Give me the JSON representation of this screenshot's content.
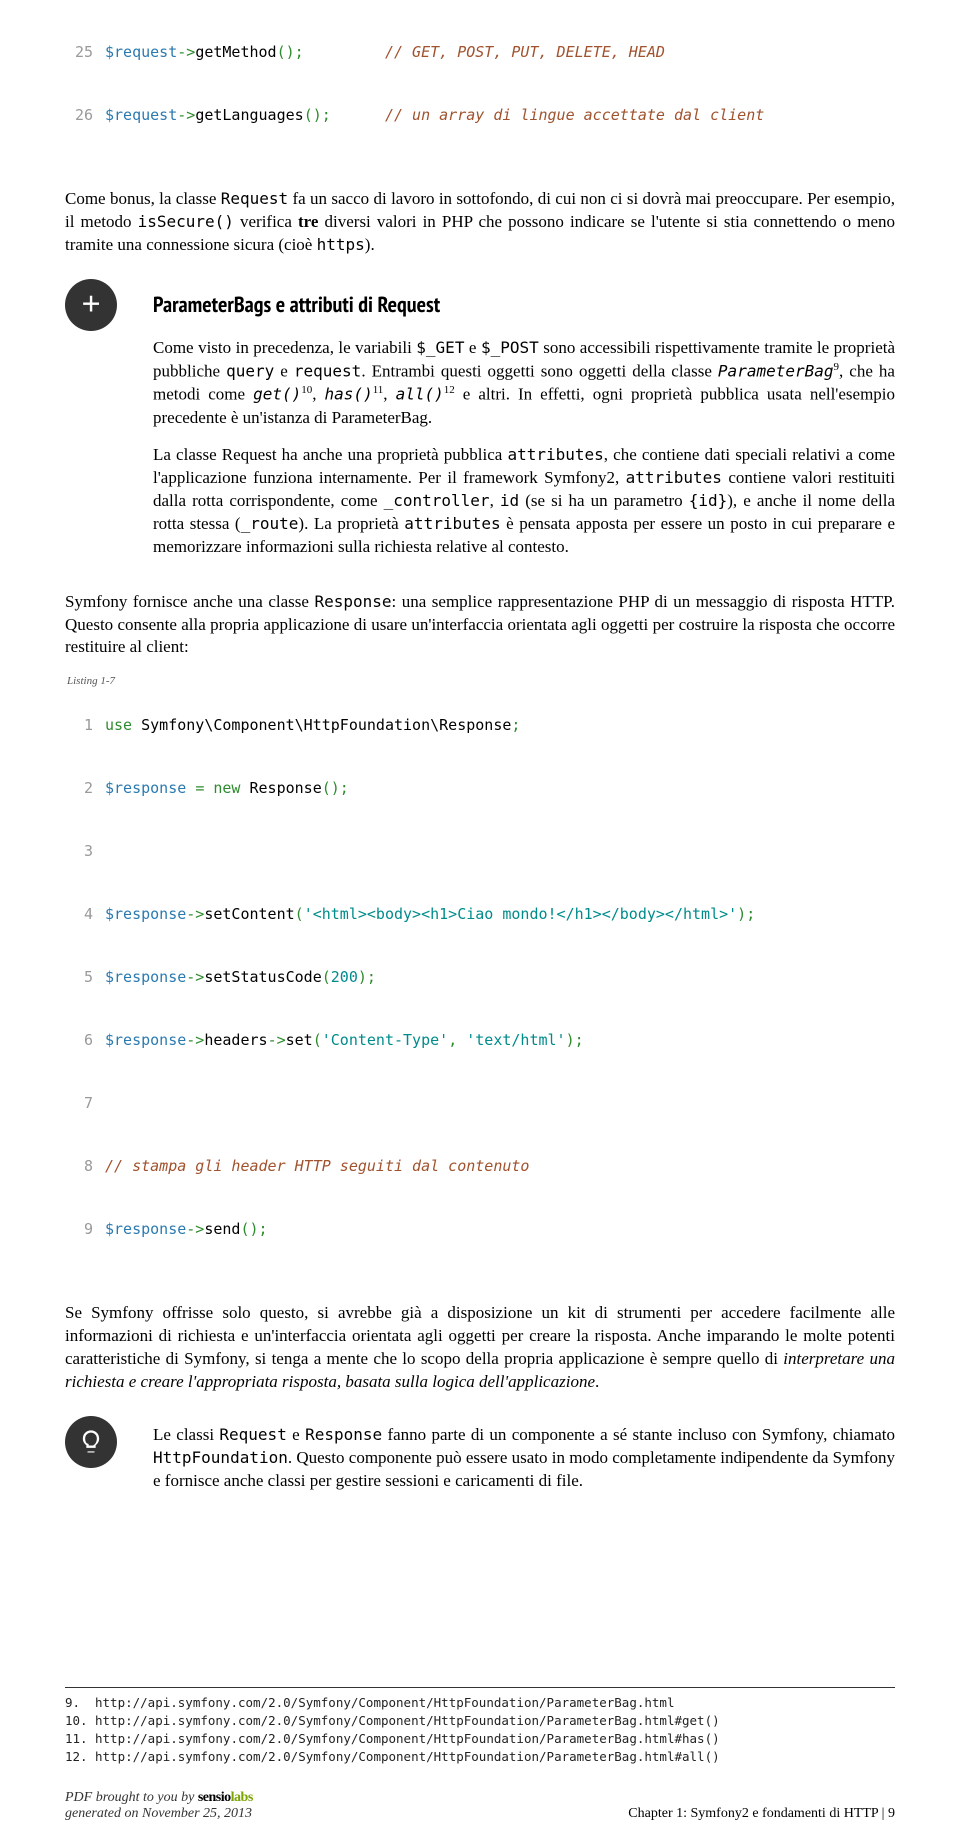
{
  "code1": {
    "lines": [
      {
        "n": "25",
        "var": "$request",
        "arrow": "->",
        "fn": "getMethod",
        "parens": "();",
        "pad": "         ",
        "comment": "// GET, POST, PUT, DELETE, HEAD"
      },
      {
        "n": "26",
        "var": "$request",
        "arrow": "->",
        "fn": "getLanguages",
        "parens": "();",
        "pad": "      ",
        "comment": "// un array di lingue accettate dal client"
      }
    ]
  },
  "para1": {
    "t1": "Come bonus, la classe ",
    "c1": "Request",
    "t2": " fa un sacco di lavoro in sottofondo, di cui non ci si dovrà mai preoccupare. Per esempio, il metodo ",
    "c2": "isSecure()",
    "t3": " verifica ",
    "b1": "tre",
    "t4": " diversi valori in PHP che possono indicare se l'utente si stia connettendo o meno tramite una connessione sicura (cioè ",
    "c3": "https",
    "t5": ")."
  },
  "callout1": {
    "title": "ParameterBags e attributi di Request",
    "p1": {
      "t1": "Come visto in precedenza, le variabili ",
      "c1": "$_GET",
      "t2": " e ",
      "c2": "$_POST",
      "t3": " sono accessibili rispettivamente tramite le proprietà pubbliche ",
      "c3": "query",
      "t4": " e ",
      "c4": "request",
      "t5": ". Entrambi questi oggetti sono oggetti della classe ",
      "c5": "ParameterBag",
      "s1": "9",
      "t6": ", che ha metodi come ",
      "c6": "get()",
      "s2": "10",
      "t7": ", ",
      "c7": "has()",
      "s3": "11",
      "t8": ", ",
      "c8": "all()",
      "s4": "12",
      "t9": " e altri. In effetti, ogni proprietà pubblica usata nell'esempio precedente è un'istanza di ParameterBag."
    },
    "p2": {
      "t1": "La classe Request ha anche una proprietà pubblica ",
      "c1": "attributes",
      "t2": ", che contiene dati speciali relativi a come l'applicazione funziona internamente. Per il framework Symfony2, ",
      "c2": "attributes",
      "t3": " contiene valori restituiti dalla rotta corrispondente, come ",
      "c3": "_controller",
      "t4": ", ",
      "c4": "id",
      "t5": " (se si ha un parametro ",
      "c5": "{id}",
      "t6": "), e anche il nome della rotta stessa (",
      "c6": "_route",
      "t7": "). La proprietà ",
      "c7": "attributes",
      "t8": " è pensata apposta per essere un posto in cui preparare e memorizzare informazioni sulla richiesta relative al contesto."
    }
  },
  "para2": {
    "t1": "Symfony fornisce anche una classe ",
    "c1": "Response",
    "t2": ": una semplice rappresentazione PHP di un messaggio di risposta HTTP. Questo consente alla propria applicazione di usare un'interfaccia orientata agli oggetti per costruire la risposta che occorre restituire al client:"
  },
  "listing": {
    "label": "Listing 1-7"
  },
  "code2": {
    "l1": {
      "n": "1",
      "use": "use",
      "ns": " Symfony\\Component\\HttpFoundation\\Response",
      "sc": ";"
    },
    "l2": {
      "n": "2",
      "v": "$response ",
      "eq": "=",
      "sp": " ",
      "new": "new",
      "cls": " Response",
      "p": "();"
    },
    "l3": {
      "n": "3"
    },
    "l4": {
      "n": "4",
      "v": "$response",
      "ar": "->",
      "fn": "setContent",
      "op": "(",
      "s": "'<html><body><h1>Ciao mondo!</h1></body></html>'",
      "cp": ");"
    },
    "l5": {
      "n": "5",
      "v": "$response",
      "ar": "->",
      "fn": "setStatusCode",
      "op": "(",
      "num": "200",
      "cp": ");"
    },
    "l6": {
      "n": "6",
      "v": "$response",
      "ar": "->",
      "fn": "headers",
      "ar2": "->",
      "fn2": "set",
      "op": "(",
      "s1": "'Content-Type'",
      "cm": ",",
      "sp": " ",
      "s2": "'text/html'",
      "cp": ");"
    },
    "l7": {
      "n": "7"
    },
    "l8": {
      "n": "8",
      "c": "// stampa gli header HTTP seguiti dal contenuto"
    },
    "l9": {
      "n": "9",
      "v": "$response",
      "ar": "->",
      "fn": "send",
      "p": "();"
    }
  },
  "para3": {
    "t1": "Se Symfony offrisse solo questo, si avrebbe già a disposizione un kit di strumenti per accedere facilmente alle informazioni di richiesta e un'interfaccia orientata agli oggetti per creare la risposta. Anche imparando le molte potenti caratteristiche di Symfony, si tenga a mente che lo scopo della propria applicazione è sempre quello di ",
    "i1": "interpretare una richiesta e creare l'appropriata risposta, basata sulla logica dell'applicazione",
    "t2": "."
  },
  "callout2": {
    "t1": "Le classi ",
    "c1": "Request",
    "t2": " e ",
    "c2": "Response",
    "t3": " fanno parte di un componente a sé stante incluso con Symfony, chiamato ",
    "c3": "HttpFoundation",
    "t4": ". Questo componente può essere usato in modo completamente indipendente da Symfony e fornisce anche classi per gestire sessioni e caricamenti di file."
  },
  "footnotes": [
    {
      "n": "9.",
      "url": "http://api.symfony.com/2.0/Symfony/Component/HttpFoundation/ParameterBag.html"
    },
    {
      "n": "10.",
      "url": "http://api.symfony.com/2.0/Symfony/Component/HttpFoundation/ParameterBag.html#get()"
    },
    {
      "n": "11.",
      "url": "http://api.symfony.com/2.0/Symfony/Component/HttpFoundation/ParameterBag.html#has()"
    },
    {
      "n": "12.",
      "url": "http://api.symfony.com/2.0/Symfony/Component/HttpFoundation/ParameterBag.html#all()"
    }
  ],
  "footer": {
    "left1": "PDF brought to you by ",
    "brand1": "sensio",
    "brand2": "labs",
    "left2": "generated on November 25, 2013",
    "right": "Chapter 1: Symfony2 e fondamenti di HTTP | 9"
  }
}
